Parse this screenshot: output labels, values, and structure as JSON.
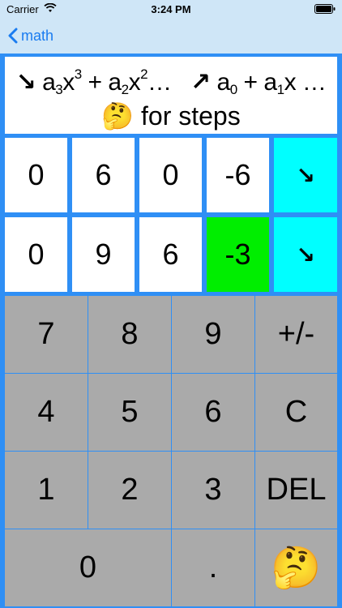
{
  "status": {
    "carrier": "Carrier",
    "time": "3:24 PM"
  },
  "nav": {
    "back_label": "math",
    "back_icon": "chevron-left-icon"
  },
  "prompt": {
    "line1_desc_arrow": "↘",
    "a3": "a",
    "a3_sub": "3",
    "x3": "x",
    "x3_sup": "3",
    "plus1": "+",
    "a2": "a",
    "a2_sub": "2",
    "x2": "x",
    "x2_sup": "2",
    "ellipsis1": "…",
    "line1_asc_arrow": "↗",
    "a0": "a",
    "a0_sub": "0",
    "plus2": "+",
    "a1": "a",
    "a1_sub": "1",
    "x1": "x",
    "ellipsis2": "…",
    "emoji": "🤔",
    "steps_text": "for steps"
  },
  "inputs": {
    "row1": [
      "0",
      "6",
      "0",
      "-6",
      "↘"
    ],
    "row2": [
      "0",
      "9",
      "6",
      "-3",
      "↘"
    ]
  },
  "keypad": {
    "row1": [
      "7",
      "8",
      "9",
      "+/-"
    ],
    "row2": [
      "4",
      "5",
      "6",
      "C"
    ],
    "row3": [
      "1",
      "2",
      "3",
      "DEL"
    ],
    "row4": [
      "0",
      ".",
      "🤔"
    ]
  },
  "colors": {
    "background": "#2f8ff5",
    "nav_bar": "#cfe6f7",
    "nav_tint": "#1a7cf0",
    "arrow_cell": "#00ffff",
    "active_cell": "#00ee00",
    "keypad": "#aaaaaa"
  }
}
